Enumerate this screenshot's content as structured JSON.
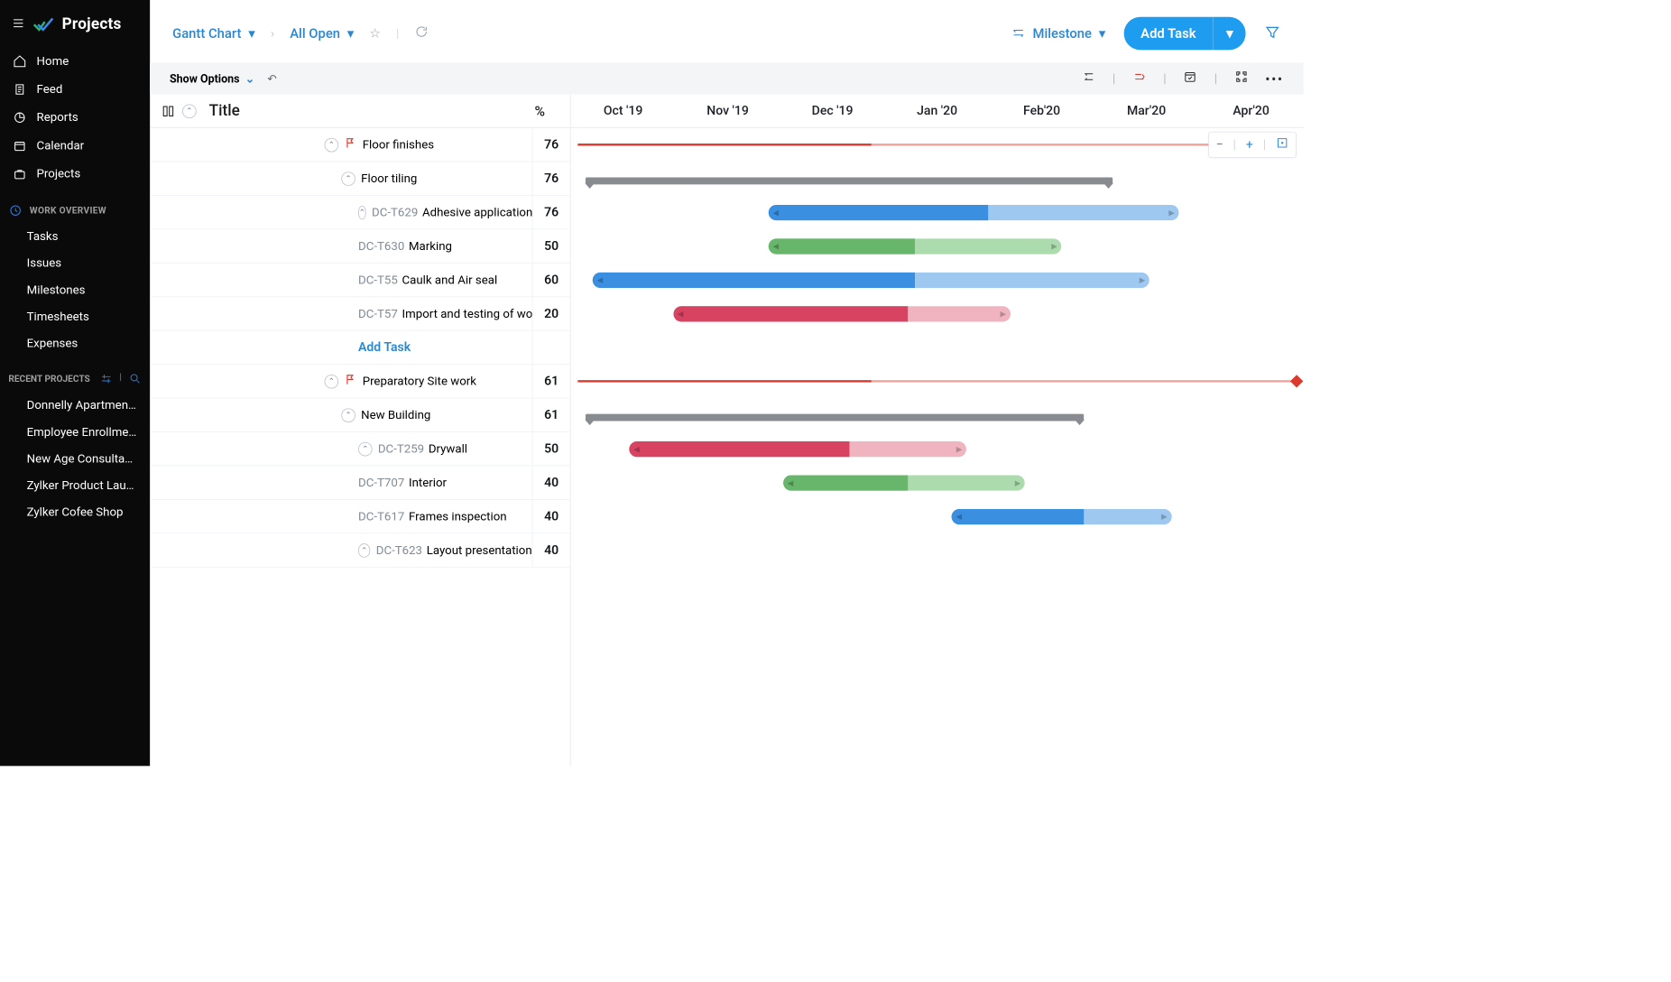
{
  "brand": "Projects",
  "sidebar": {
    "nav": [
      {
        "icon": "home",
        "label": "Home"
      },
      {
        "icon": "feed",
        "label": "Feed"
      },
      {
        "icon": "reports",
        "label": "Reports"
      },
      {
        "icon": "calendar",
        "label": "Calendar"
      },
      {
        "icon": "projects",
        "label": "Projects"
      }
    ],
    "section_title": "WORK OVERVIEW",
    "work": [
      "Tasks",
      "Issues",
      "Milestones",
      "Timesheets",
      "Expenses"
    ],
    "recent_title": "RECENT PROJECTS",
    "recent": [
      "Donnelly Apartments",
      "Employee Enrollment",
      "New Age Consultancy",
      "Zylker Product Launch",
      "Zylker Cofee Shop"
    ]
  },
  "topbar": {
    "view": "Gantt Chart",
    "filter": "All Open",
    "milestone_label": "Milestone",
    "add_task": "Add Task"
  },
  "options": {
    "show": "Show Options"
  },
  "grid": {
    "title_header": "Title",
    "pct_header": "%"
  },
  "timeline": {
    "months": [
      "Oct '19",
      "Nov '19",
      "Dec '19",
      "Jan '20",
      "Feb'20",
      "Mar'20",
      "Apr'20"
    ]
  },
  "rows": [
    {
      "kind": "milestone",
      "indent": 1,
      "label": "Floor finishes",
      "pct": "76",
      "bar": {
        "type": "ms",
        "start": 1,
        "done": 40,
        "end": 96
      }
    },
    {
      "kind": "group",
      "indent": 2,
      "label": "Floor tiling",
      "pct": "76",
      "bar": {
        "type": "grp",
        "start": 2,
        "end": 74
      }
    },
    {
      "kind": "task",
      "indent": 3,
      "id": "DC-T629",
      "label": "Adhesive application",
      "pct": "76",
      "bar": {
        "type": "task",
        "color": "#3b8fe0",
        "light": "#9ec8f0",
        "start": 27,
        "done": 30,
        "len": 56
      }
    },
    {
      "kind": "leaf",
      "indent": 3,
      "id": "DC-T630",
      "label": "Marking",
      "pct": "50",
      "bar": {
        "type": "task",
        "color": "#68b66b",
        "light": "#acdcae",
        "start": 27,
        "done": 20,
        "len": 40
      }
    },
    {
      "kind": "leaf",
      "indent": 3,
      "id": "DC-T55",
      "label": "Caulk and Air seal",
      "pct": "60",
      "bar": {
        "type": "task",
        "color": "#3b8fe0",
        "light": "#9ec8f0",
        "start": 3,
        "done": 44,
        "len": 76
      }
    },
    {
      "kind": "leaf",
      "indent": 3,
      "id": "DC-T57",
      "label": "Import and testing of woo..",
      "pct": "20",
      "bar": {
        "type": "task",
        "color": "#d74361",
        "light": "#efb4c0",
        "start": 14,
        "done": 32,
        "len": 46
      }
    },
    {
      "kind": "add",
      "indent": 3,
      "label": "Add Task"
    },
    {
      "kind": "milestone",
      "indent": 1,
      "label": "Preparatory Site work",
      "pct": "61",
      "bar": {
        "type": "ms",
        "start": 1,
        "done": 40,
        "end": 99
      }
    },
    {
      "kind": "group",
      "indent": 2,
      "label": "New Building",
      "pct": "61",
      "bar": {
        "type": "grp",
        "start": 2,
        "end": 70
      }
    },
    {
      "kind": "task",
      "indent": 3,
      "id": "DC-T259",
      "label": "Drywall",
      "pct": "50",
      "bar": {
        "type": "task",
        "color": "#d74361",
        "light": "#efb4c0",
        "start": 8,
        "done": 30,
        "len": 46
      }
    },
    {
      "kind": "leaf",
      "indent": 3,
      "id": "DC-T707",
      "label": "Interior",
      "pct": "40",
      "bar": {
        "type": "task",
        "color": "#68b66b",
        "light": "#acdcae",
        "start": 29,
        "done": 17,
        "len": 33
      }
    },
    {
      "kind": "leaf",
      "indent": 3,
      "id": "DC-T617",
      "label": "Frames inspection",
      "pct": "40",
      "bar": {
        "type": "task",
        "color": "#3b8fe0",
        "light": "#9ec8f0",
        "start": 52,
        "done": 18,
        "len": 30
      }
    },
    {
      "kind": "task",
      "indent": 3,
      "id": "DC-T623",
      "label": "Layout presentation",
      "pct": "40"
    }
  ]
}
